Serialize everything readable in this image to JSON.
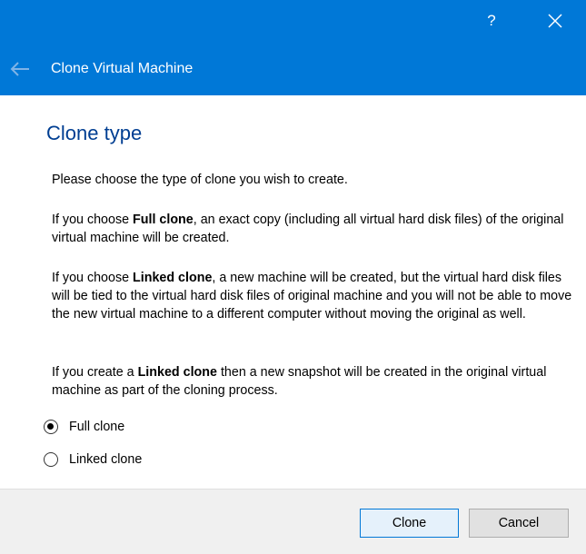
{
  "window": {
    "title": "Clone Virtual Machine",
    "help_label": "?",
    "accent_color": "#0078d7"
  },
  "page": {
    "title": "Clone type",
    "intro": "Please choose the type of clone you wish to create.",
    "full_prefix": "If you choose ",
    "full_term": "Full clone",
    "full_suffix": ", an exact copy (including all virtual hard disk files) of the original virtual machine will be created.",
    "linked_prefix": "If you choose ",
    "linked_term": "Linked clone",
    "linked_suffix": ", a new machine will be created, but the virtual hard disk files will be tied to the virtual hard disk files of original machine and you will not be able to move the new virtual machine to a different computer without moving the original as well.",
    "snapshot_prefix": "If you create a ",
    "snapshot_term": "Linked clone",
    "snapshot_suffix": " then a new snapshot will be created in the original virtual machine as part of the cloning process."
  },
  "options": {
    "full_clone_label": "Full clone",
    "linked_clone_label": "Linked clone",
    "selected": "Full clone"
  },
  "buttons": {
    "clone_label": "Clone",
    "cancel_label": "Cancel"
  }
}
